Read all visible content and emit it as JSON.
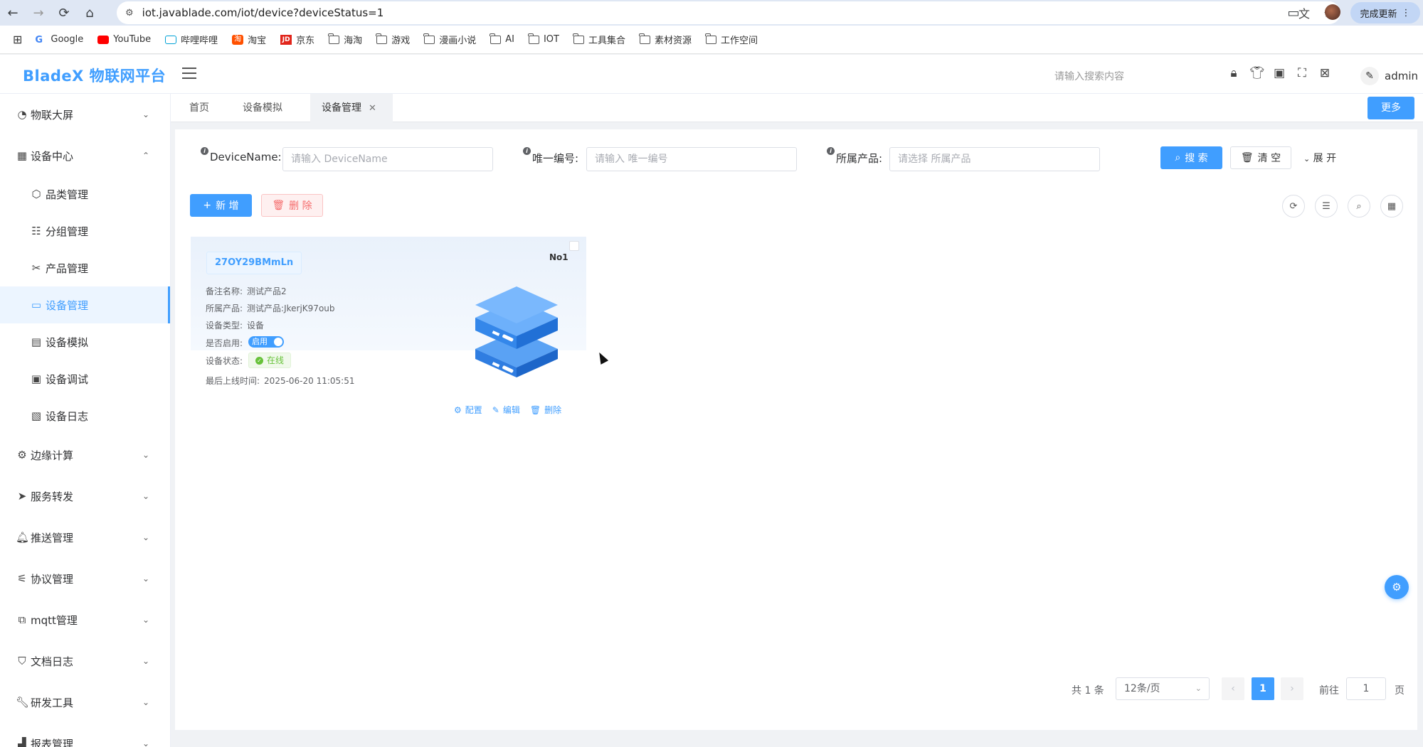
{
  "browser": {
    "url": "iot.javablade.com/iot/device?deviceStatus=1",
    "update_label": "完成更新",
    "bookmarks": [
      "Google",
      "YouTube",
      "哔哩哔哩",
      "淘宝",
      "京东",
      "海淘",
      "游戏",
      "漫画小说",
      "AI",
      "IOT",
      "工具集合",
      "素材资源",
      "工作空间"
    ]
  },
  "header": {
    "logo": "BladeX 物联网平台",
    "search_placeholder": "请输入搜索内容",
    "username": "admin"
  },
  "sidebar": {
    "items": [
      {
        "label": "物联大屏",
        "icon": "dashboard-icon",
        "expanded": false
      },
      {
        "label": "设备中心",
        "icon": "grid-icon",
        "expanded": true
      },
      {
        "label": "边缘计算",
        "icon": "edge-icon",
        "expanded": false
      },
      {
        "label": "服务转发",
        "icon": "send-icon",
        "expanded": false
      },
      {
        "label": "推送管理",
        "icon": "bell-icon",
        "expanded": false
      },
      {
        "label": "协议管理",
        "icon": "antenna-icon",
        "expanded": false
      },
      {
        "label": "mqtt管理",
        "icon": "mqtt-icon",
        "expanded": false
      },
      {
        "label": "文档日志",
        "icon": "shield-icon",
        "expanded": false
      },
      {
        "label": "研发工具",
        "icon": "wrench-icon",
        "expanded": false
      },
      {
        "label": "报表管理",
        "icon": "chart-icon",
        "expanded": false
      }
    ],
    "sub_items": [
      {
        "label": "品类管理",
        "icon": "cube-icon"
      },
      {
        "label": "分组管理",
        "icon": "group-icon"
      },
      {
        "label": "产品管理",
        "icon": "tools-icon"
      },
      {
        "label": "设备管理",
        "icon": "monitor-icon",
        "active": true
      },
      {
        "label": "设备模拟",
        "icon": "simulator-icon"
      },
      {
        "label": "设备调试",
        "icon": "debug-icon"
      },
      {
        "label": "设备日志",
        "icon": "log-icon"
      }
    ]
  },
  "tabs": [
    "首页",
    "设备模拟",
    "设备管理"
  ],
  "more_label": "更多",
  "search_form": {
    "device_name_label": "DeviceName:",
    "device_name_placeholder": "请输入 DeviceName",
    "unique_id_label": "唯一编号:",
    "unique_id_placeholder": "请输入 唯一编号",
    "product_label": "所属产品:",
    "product_placeholder": "请选择 所属产品",
    "search_label": "搜 索",
    "clear_label": "清 空",
    "expand_label": "展 开"
  },
  "toolbar": {
    "add_label": "新 增",
    "delete_label": "删 除"
  },
  "device": {
    "name": "27OY29BMmLn",
    "no": "No1",
    "remark_label": "备注名称:",
    "remark_value": "测试产品2",
    "product_label": "所属产品:",
    "product_value": "测试产品:JkerjK97oub",
    "type_label": "设备类型:",
    "type_value": "设备",
    "enabled_label": "是否启用:",
    "enabled_value": "启用",
    "status_label": "设备状态:",
    "status_value": "在线",
    "last_online_label": "最后上线时间:",
    "last_online_value": "2025-06-20 11:05:51",
    "actions": [
      "配置",
      "编辑",
      "删除"
    ]
  },
  "pagination": {
    "total": "共 1 条",
    "page_size": "12条/页",
    "current_page": "1",
    "goto_label": "前往",
    "goto_value": "1",
    "page_unit": "页"
  },
  "colors": {
    "primary": "#409eff",
    "danger": "#f56c6c",
    "success": "#67c23a"
  }
}
